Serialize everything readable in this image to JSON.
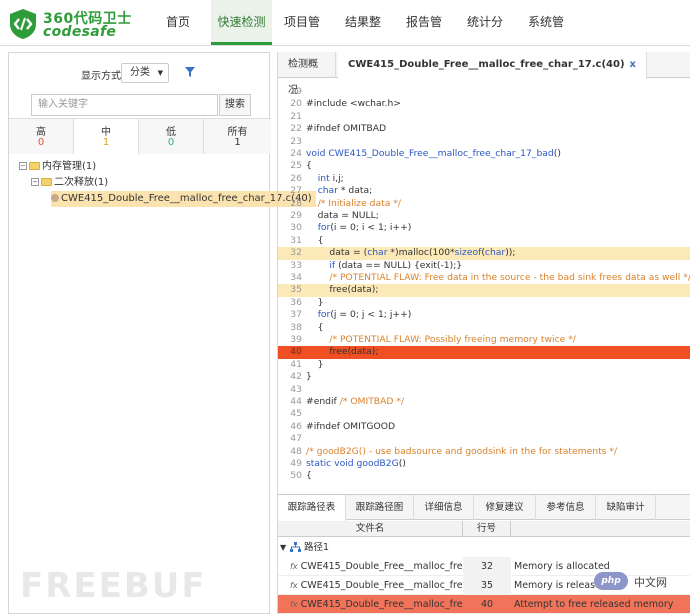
{
  "brand": {
    "name_cn": "360代码卫士",
    "name_en": "codesafe"
  },
  "nav": {
    "items": [
      {
        "label": "首页"
      },
      {
        "label": "快速检测"
      },
      {
        "label": "项目管理"
      },
      {
        "label": "结果整合"
      },
      {
        "label": "报告管理"
      },
      {
        "label": "统计分析"
      },
      {
        "label": "系统管理"
      }
    ],
    "active_index": 1
  },
  "left": {
    "display_label": "显示方式：",
    "display_value": "分类",
    "search_placeholder": "输入关键字",
    "search_button": "搜索",
    "severity_tabs": [
      {
        "label": "高",
        "count": "0",
        "color": "#e0533a"
      },
      {
        "label": "中",
        "count": "1",
        "color": "#e0a11a"
      },
      {
        "label": "低",
        "count": "0",
        "color": "#3aa97a"
      },
      {
        "label": "所有",
        "count": "1",
        "color": "#333333"
      }
    ],
    "active_severity": 1,
    "tree": [
      {
        "label": "内存管理(1)",
        "level": 0,
        "type": "folder"
      },
      {
        "label": "二次释放(1)",
        "level": 1,
        "type": "folder"
      },
      {
        "label": "CWE415_Double_Free__malloc_free_char_17.c(40)",
        "level": 2,
        "type": "file"
      }
    ]
  },
  "editor": {
    "tabs": [
      {
        "label": "检测概况"
      },
      {
        "label": "CWE415_Double_Free__malloc_free_char_17.c(40)",
        "close": "x"
      }
    ],
    "lines": [
      {
        "n": "19",
        "t": "",
        "h": ""
      },
      {
        "n": "20",
        "t": "#include <wchar.h>",
        "h": ""
      },
      {
        "n": "21",
        "t": "",
        "h": ""
      },
      {
        "n": "22",
        "t": "#ifndef OMITBAD",
        "h": ""
      },
      {
        "n": "23",
        "t": "",
        "h": ""
      },
      {
        "n": "24",
        "t": "void CWE415_Double_Free__malloc_free_char_17_bad()",
        "h": ""
      },
      {
        "n": "25",
        "t": "{",
        "h": ""
      },
      {
        "n": "26",
        "t": "    int i,j;",
        "h": ""
      },
      {
        "n": "27",
        "t": "    char * data;",
        "h": ""
      },
      {
        "n": "28",
        "t": "    /* Initialize data */",
        "h": ""
      },
      {
        "n": "29",
        "t": "    data = NULL;",
        "h": ""
      },
      {
        "n": "30",
        "t": "    for(i = 0; i < 1; i++)",
        "h": ""
      },
      {
        "n": "31",
        "t": "    {",
        "h": ""
      },
      {
        "n": "32",
        "t": "        data = (char *)malloc(100*sizeof(char));",
        "h": "hl"
      },
      {
        "n": "33",
        "t": "        if (data == NULL) {exit(-1);}",
        "h": ""
      },
      {
        "n": "34",
        "t": "        /* POTENTIAL FLAW: Free data in the source - the bad sink frees data as well */",
        "h": ""
      },
      {
        "n": "35",
        "t": "        free(data);",
        "h": "hl"
      },
      {
        "n": "36",
        "t": "    }",
        "h": ""
      },
      {
        "n": "37",
        "t": "    for(j = 0; j < 1; j++)",
        "h": ""
      },
      {
        "n": "38",
        "t": "    {",
        "h": ""
      },
      {
        "n": "39",
        "t": "        /* POTENTIAL FLAW: Possibly freeing memory twice */",
        "h": ""
      },
      {
        "n": "40",
        "t": "        free(data);",
        "h": "err"
      },
      {
        "n": "41",
        "t": "    }",
        "h": ""
      },
      {
        "n": "42",
        "t": "}",
        "h": ""
      },
      {
        "n": "43",
        "t": "",
        "h": ""
      },
      {
        "n": "44",
        "t": "#endif /* OMITBAD */",
        "h": ""
      },
      {
        "n": "45",
        "t": "",
        "h": ""
      },
      {
        "n": "46",
        "t": "#ifndef OMITGOOD",
        "h": ""
      },
      {
        "n": "47",
        "t": "",
        "h": ""
      },
      {
        "n": "48",
        "t": "/* goodB2G() - use badsource and goodsink in the for statements */",
        "h": ""
      },
      {
        "n": "49",
        "t": "static void goodB2G()",
        "h": ""
      },
      {
        "n": "50",
        "t": "{",
        "h": ""
      }
    ]
  },
  "bottom": {
    "tabs": [
      {
        "label": "跟踪路径表"
      },
      {
        "label": "跟踪路径图"
      },
      {
        "label": "详细信息"
      },
      {
        "label": "修复建议"
      },
      {
        "label": "参考信息"
      },
      {
        "label": "缺陷审计"
      }
    ],
    "active_tab": 0,
    "columns": {
      "file": "文件名",
      "line": "行号",
      "desc": ""
    },
    "group_label": "路径1",
    "rows": [
      {
        "file": "CWE415_Double_Free__malloc_free_...",
        "line": "32",
        "desc": "Memory is allocated"
      },
      {
        "file": "CWE415_Double_Free__malloc_free_...",
        "line": "35",
        "desc": "Memory is released"
      },
      {
        "file": "CWE415_Double_Free__malloc_free_...",
        "line": "40",
        "desc": "Attempt to free released memory"
      }
    ]
  },
  "watermark": {
    "text": "FREEBUF"
  },
  "badge": {
    "logo": "php",
    "text": "中文网"
  }
}
